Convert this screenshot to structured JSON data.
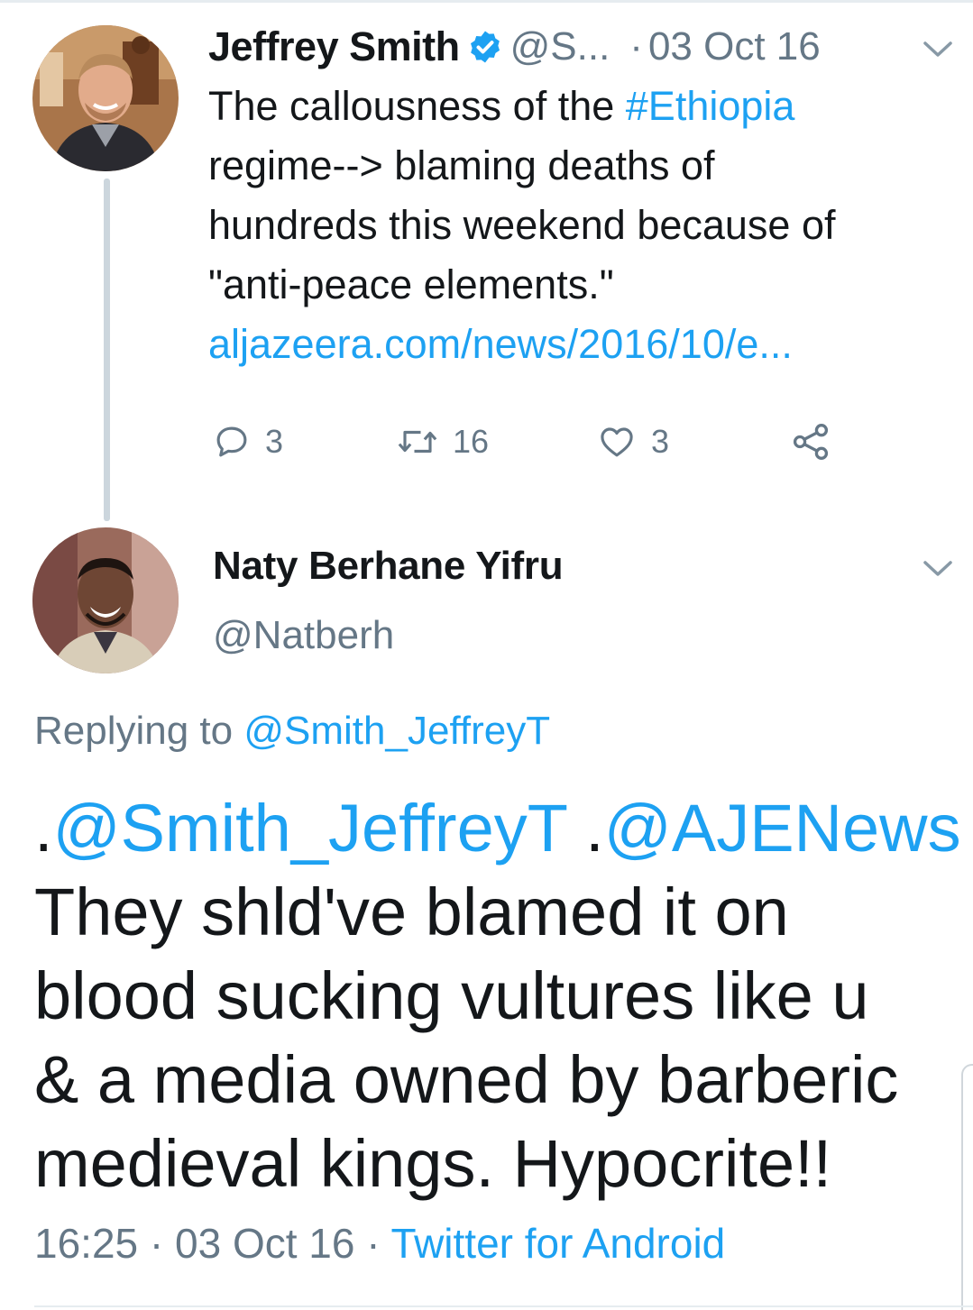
{
  "tweet1": {
    "author_name": "Jeffrey Smith",
    "handle": "@S...",
    "separator": "·",
    "date": "03 Oct 16",
    "text_lines": [
      [
        "The callousness of the ",
        "#Ethiopia"
      ],
      [
        "regime--> blaming deaths of"
      ],
      [
        "hundreds this weekend because of"
      ],
      [
        "\"anti-peace elements.\""
      ]
    ],
    "link": "aljazeera.com/news/2016/10/e...",
    "reply_count": "3",
    "retweet_count": "16",
    "like_count": "3"
  },
  "tweet2": {
    "author_name": "Naty Berhane Yifru",
    "handle": "@Natberh",
    "replying_prefix": "Replying to ",
    "replying_to": "@Smith_JeffreyT",
    "mention_dot_1": ".",
    "mention_1": "@Smith_JeffreyT",
    "mention_dot_2": " .",
    "mention_2": "@AJENews",
    "text_lines": [
      "They shld've blamed it on",
      "blood sucking vultures like u",
      "& a media owned by barberic",
      "medieval kings. Hypocrite!!"
    ],
    "time": "16:25",
    "separator": "·",
    "date": "03 Oct 16",
    "source": "Twitter for Android"
  },
  "colors": {
    "accent": "#1da1f2",
    "muted": "#657786",
    "text": "#14171a",
    "thread_line": "#ccd6dd"
  },
  "icons": [
    "verified-badge-icon",
    "chevron-down-icon",
    "reply-icon",
    "retweet-icon",
    "like-icon",
    "share-icon"
  ]
}
